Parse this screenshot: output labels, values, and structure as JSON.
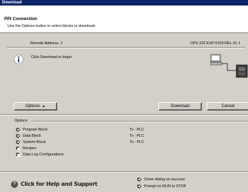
{
  "window": {
    "title": "Download"
  },
  "header": {
    "title": "PPI Connection",
    "subtitle": "Use the Options button to select blocks to download."
  },
  "connection": {
    "remote_address": "Remote Address: 2",
    "cpu_info": "CPU 222 EXP 0103 REL 01.1",
    "message": "Click Download to begin."
  },
  "buttons": {
    "options": "Options",
    "download": "Download",
    "cancel": "Cancel"
  },
  "options": {
    "group_label": "Options",
    "items": [
      {
        "label": "Program Block",
        "checked": true,
        "target": "To : PLC"
      },
      {
        "label": "Data Block",
        "checked": true,
        "target": "To : PLC"
      },
      {
        "label": "System Block",
        "checked": true,
        "target": "To : PLC"
      },
      {
        "label": "Recipes",
        "checked": false,
        "target": ""
      },
      {
        "label": "Data Log Configurations",
        "checked": false,
        "target": ""
      }
    ]
  },
  "footer": {
    "help_text": "Click for Help and Support",
    "close_on_success": {
      "label": "Close dialog on success",
      "checked": true
    },
    "prompt_run_to_stop": {
      "label": "Prompt on RUN to STOP",
      "checked": true
    }
  },
  "icons": [
    "info-icon",
    "computer-plc-icon",
    "chevron-up-icon",
    "help-icon",
    "check-icon"
  ]
}
